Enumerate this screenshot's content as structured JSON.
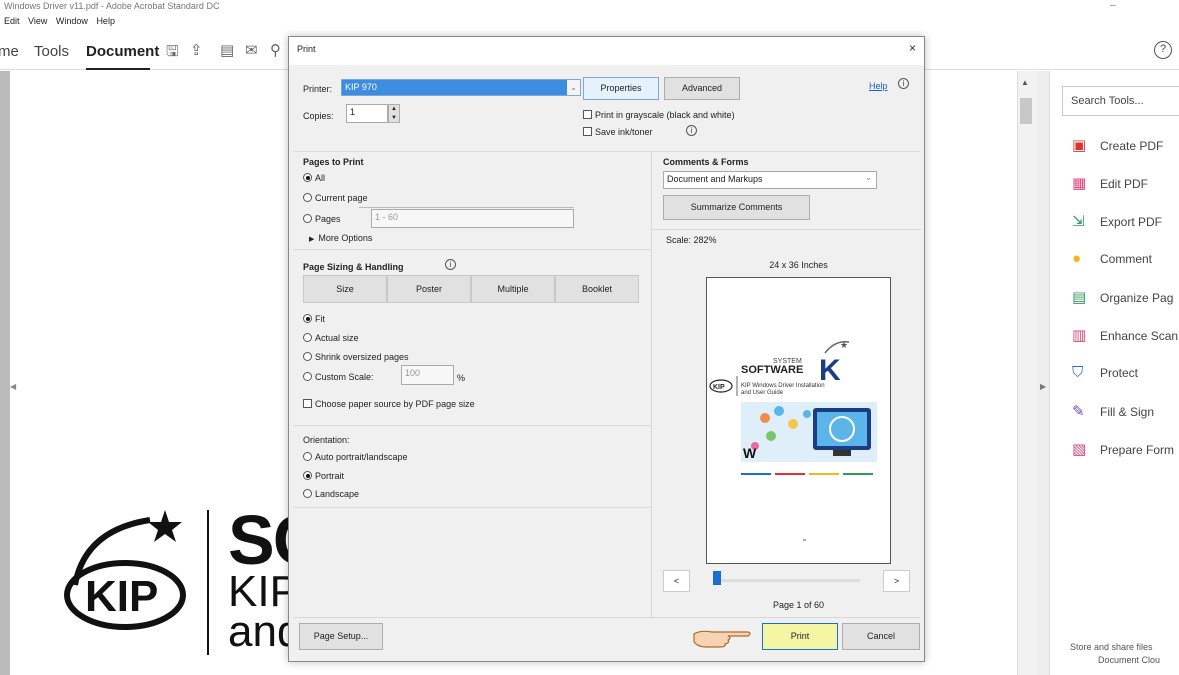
{
  "window": {
    "title": "Windows Driver v11.pdf - Adobe Acrobat Standard DC",
    "minimize": "–",
    "menu": [
      "Edit",
      "View",
      "Window",
      "Help"
    ]
  },
  "acrobat_toolbar": {
    "tabs": [
      "me",
      "Tools",
      "Document"
    ],
    "help": "?"
  },
  "document_bg": {
    "big_text": "SC",
    "line1": "KIP",
    "line2": "and",
    "logo": "KIP"
  },
  "tools_pane": {
    "search_placeholder": "Search Tools...",
    "items": [
      {
        "label": "Create PDF",
        "icon": "create-pdf-icon",
        "color": "#e0322f"
      },
      {
        "label": "Edit PDF",
        "icon": "edit-pdf-icon",
        "color": "#e0447a"
      },
      {
        "label": "Export PDF",
        "icon": "export-pdf-icon",
        "color": "#2d9b5a"
      },
      {
        "label": "Comment",
        "icon": "comment-icon",
        "color": "#f2b81b"
      },
      {
        "label": "Organize Pag",
        "icon": "organize-pages-icon",
        "color": "#2d9b5a"
      },
      {
        "label": "Enhance Scan",
        "icon": "enhance-scan-icon",
        "color": "#e0447a"
      },
      {
        "label": "Protect",
        "icon": "protect-icon",
        "color": "#2a6fd0"
      },
      {
        "label": "Fill & Sign",
        "icon": "fill-sign-icon",
        "color": "#6a4bc4"
      },
      {
        "label": "Prepare Form",
        "icon": "prepare-form-icon",
        "color": "#e0447a"
      }
    ],
    "store_line1": "Store and share files",
    "store_line2": "Document Clou"
  },
  "print_dialog": {
    "title": "Print",
    "close": "×",
    "printer_label": "Printer:",
    "printer_value": "KIP 970",
    "properties": "Properties",
    "advanced": "Advanced",
    "help": "Help",
    "copies_label": "Copies:",
    "copies_value": "1",
    "grayscale": "Print in grayscale (black and white)",
    "save_ink": "Save ink/toner",
    "pages_to_print": {
      "heading": "Pages to Print",
      "all": "All",
      "current": "Current page",
      "pages": "Pages",
      "pages_range": "1 - 60",
      "more": "More Options"
    },
    "comments_forms": {
      "heading": "Comments & Forms",
      "value": "Document and Markups",
      "summarize": "Summarize Comments"
    },
    "scale": "Scale: 282%",
    "paper_size": "24 x 36 Inches",
    "sizing": {
      "heading": "Page Sizing & Handling",
      "tabs": [
        "Size",
        "Poster",
        "Multiple",
        "Booklet"
      ],
      "fit": "Fit",
      "actual": "Actual size",
      "shrink": "Shrink oversized pages",
      "custom": "Custom Scale:",
      "custom_value": "100",
      "percent": "%",
      "paper_source": "Choose paper source by PDF page size"
    },
    "orientation": {
      "heading": "Orientation:",
      "auto": "Auto portrait/landscape",
      "portrait": "Portrait",
      "landscape": "Landscape"
    },
    "preview": {
      "system": "SYSTEM",
      "software": "SOFTWARE",
      "k": "K",
      "kip": "KIP",
      "subtitle1": "KIP Windows Driver Installation",
      "subtitle2": "and User Guide",
      "w": "W"
    },
    "nav_prev": "<",
    "nav_next": ">",
    "page_indicator": "Page 1 of 60",
    "page_setup": "Page Setup...",
    "print": "Print",
    "cancel": "Cancel"
  }
}
